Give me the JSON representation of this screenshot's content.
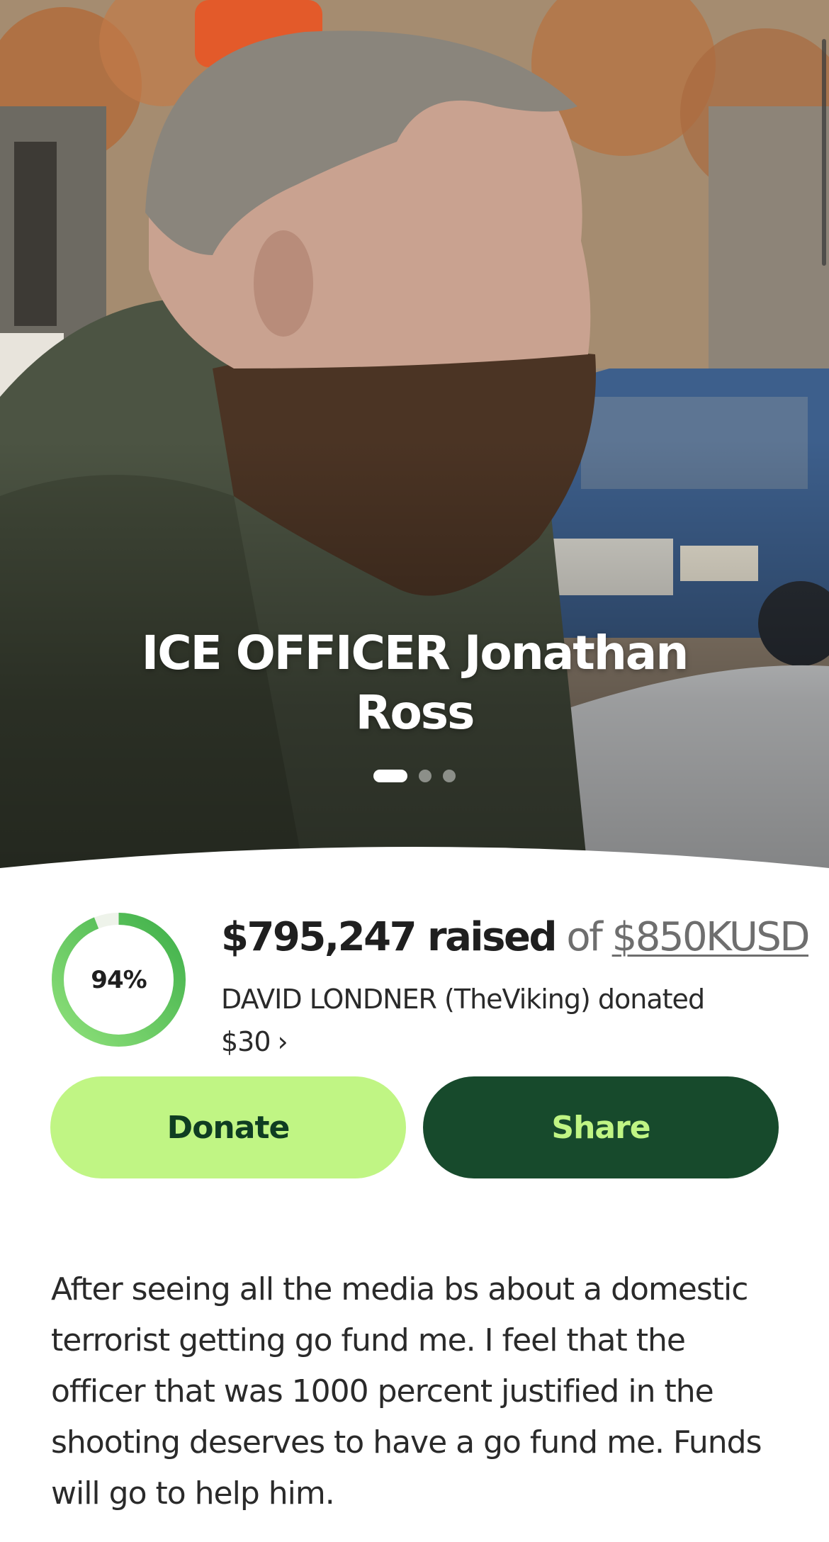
{
  "campaign": {
    "title": "ICE OFFICER Jonathan Ross",
    "photo_description_icon": "person-photo",
    "carousel": {
      "total_slides": 3,
      "active_index": 0
    }
  },
  "progress": {
    "percent_label": "94%",
    "fraction": 0.94,
    "raised_amount": "$795,247 raised",
    "of_label": "of",
    "goal_label": "$850KUSD"
  },
  "recent_donation": {
    "text": "DAVID LONDNER (TheViking) donated $30",
    "chevron": "›"
  },
  "actions": {
    "donate_label": "Donate",
    "share_label": "Share"
  },
  "description": {
    "text": "After seeing all the media bs about a domestic terrorist getting go fund me. I feel that the officer that was 1000 percent justified in the shooting deserves to have a go fund me. Funds will go to help him."
  },
  "colors": {
    "donate_bg": "#c0f584",
    "share_bg": "#174a2c",
    "accent_green": "#5cc24a"
  }
}
